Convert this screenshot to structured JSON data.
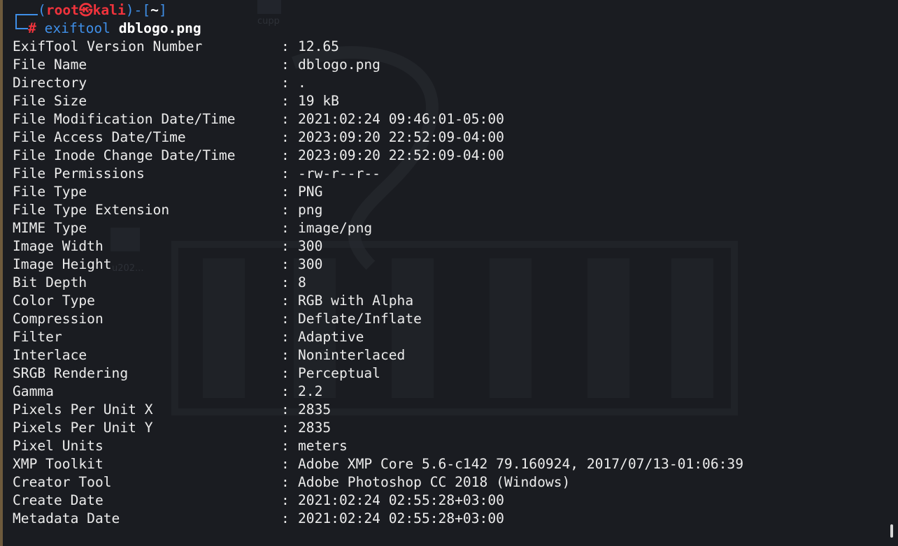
{
  "prompt": {
    "open_paren": "(",
    "user": "root",
    "at_symbol": "㉿",
    "host": "kali",
    "close_dash": ")-[",
    "path": "~",
    "close_bracket": "]",
    "hash": "#",
    "command": "exiftool",
    "argument": "dblogo.png"
  },
  "desktop_labels": {
    "folder_label_1": "cupp",
    "folder_label_2": "u202..."
  },
  "output": [
    {
      "key": "ExifTool Version Number",
      "value": "12.65"
    },
    {
      "key": "File Name",
      "value": "dblogo.png"
    },
    {
      "key": "Directory",
      "value": "."
    },
    {
      "key": "File Size",
      "value": "19 kB"
    },
    {
      "key": "File Modification Date/Time",
      "value": "2021:02:24 09:46:01-05:00"
    },
    {
      "key": "File Access Date/Time",
      "value": "2023:09:20 22:52:09-04:00"
    },
    {
      "key": "File Inode Change Date/Time",
      "value": "2023:09:20 22:52:09-04:00"
    },
    {
      "key": "File Permissions",
      "value": "-rw-r--r--"
    },
    {
      "key": "File Type",
      "value": "PNG"
    },
    {
      "key": "File Type Extension",
      "value": "png"
    },
    {
      "key": "MIME Type",
      "value": "image/png"
    },
    {
      "key": "Image Width",
      "value": "300"
    },
    {
      "key": "Image Height",
      "value": "300"
    },
    {
      "key": "Bit Depth",
      "value": "8"
    },
    {
      "key": "Color Type",
      "value": "RGB with Alpha"
    },
    {
      "key": "Compression",
      "value": "Deflate/Inflate"
    },
    {
      "key": "Filter",
      "value": "Adaptive"
    },
    {
      "key": "Interlace",
      "value": "Noninterlaced"
    },
    {
      "key": "SRGB Rendering",
      "value": "Perceptual"
    },
    {
      "key": "Gamma",
      "value": "2.2"
    },
    {
      "key": "Pixels Per Unit X",
      "value": "2835"
    },
    {
      "key": "Pixels Per Unit Y",
      "value": "2835"
    },
    {
      "key": "Pixel Units",
      "value": "meters"
    },
    {
      "key": "XMP Toolkit",
      "value": "Adobe XMP Core 5.6-c142 79.160924, 2017/07/13-01:06:39"
    },
    {
      "key": "Creator Tool",
      "value": "Adobe Photoshop CC 2018 (Windows)"
    },
    {
      "key": "Create Date",
      "value": "2021:02:24 02:55:28+03:00"
    },
    {
      "key": "Metadata Date",
      "value": "2021:02:24 02:55:28+03:00"
    }
  ],
  "separator": ":",
  "colors": {
    "background": "#1a1c21",
    "prompt_blue": "#3f8fe8",
    "prompt_red": "#f0333c",
    "text": "#ececec"
  }
}
